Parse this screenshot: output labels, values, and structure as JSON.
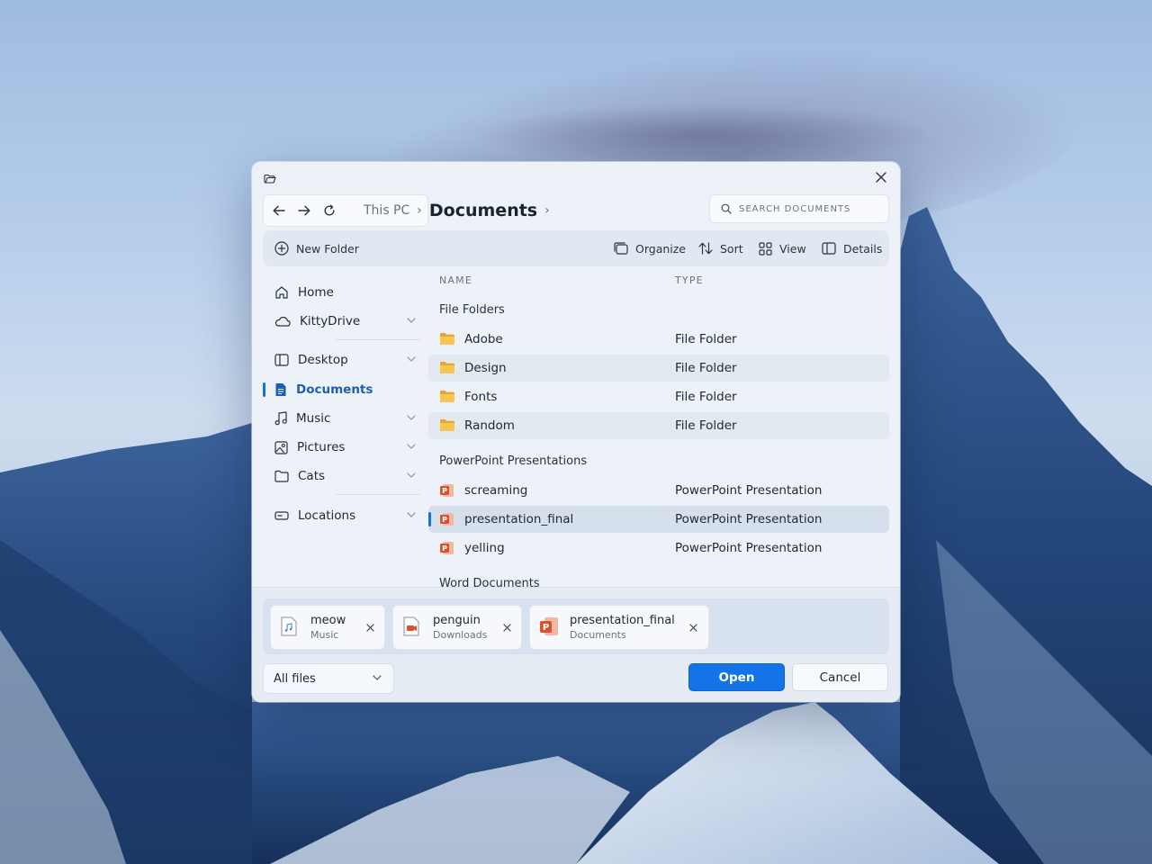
{
  "breadcrumb": {
    "root": "This PC",
    "current": "Documents"
  },
  "search": {
    "placeholder": "SEARCH DOCUMENTS"
  },
  "toolbar": {
    "new_folder": "New Folder",
    "organize": "Organize",
    "sort": "Sort",
    "view": "View",
    "details": "Details"
  },
  "sidebar": {
    "items": [
      {
        "label": "Home",
        "icon": "home-icon"
      },
      {
        "label": "KittyDrive",
        "icon": "cloud-icon"
      },
      {
        "label": "Desktop",
        "icon": "desktop-icon"
      },
      {
        "label": "Documents",
        "icon": "document-icon"
      },
      {
        "label": "Music",
        "icon": "music-icon"
      },
      {
        "label": "Pictures",
        "icon": "picture-icon"
      },
      {
        "label": "Cats",
        "icon": "folder-icon"
      },
      {
        "label": "Locations",
        "icon": "drive-icon"
      }
    ]
  },
  "columns": {
    "name": "NAME",
    "type": "TYPE"
  },
  "groups": {
    "folders": "File Folders",
    "presentations": "PowerPoint Presentations",
    "word": "Word Documents"
  },
  "files": {
    "folders": [
      {
        "name": "Adobe",
        "type": "File Folder"
      },
      {
        "name": "Design",
        "type": "File Folder"
      },
      {
        "name": "Fonts",
        "type": "File Folder"
      },
      {
        "name": "Random",
        "type": "File Folder"
      }
    ],
    "presentations": [
      {
        "name": "screaming",
        "type": "PowerPoint Presentation"
      },
      {
        "name": "presentation_final",
        "type": "PowerPoint Presentation"
      },
      {
        "name": "yelling",
        "type": "PowerPoint Presentation"
      }
    ]
  },
  "selected_files": [
    {
      "name": "meow",
      "location": "Music",
      "icon": "audio-file-icon"
    },
    {
      "name": "penguin",
      "location": "Downloads",
      "icon": "video-file-icon"
    },
    {
      "name": "presentation_final",
      "location": "Documents",
      "icon": "powerpoint-icon"
    }
  ],
  "filter": {
    "value": "All files"
  },
  "buttons": {
    "open": "Open",
    "cancel": "Cancel"
  },
  "colors": {
    "accent": "#1473e6",
    "folder": "#f4b73c",
    "powerpoint": "#d8532c"
  }
}
